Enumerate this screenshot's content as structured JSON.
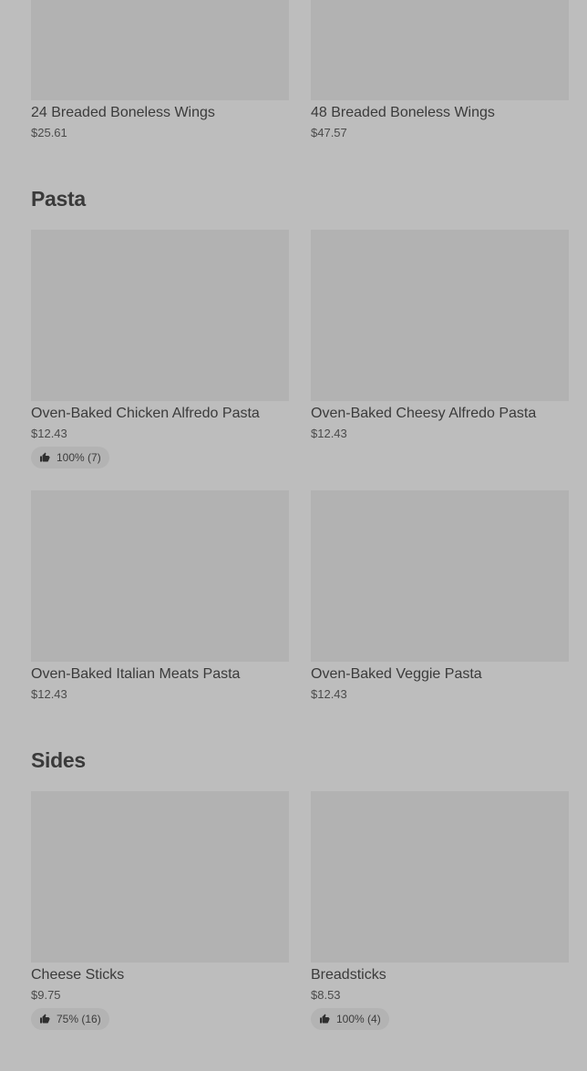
{
  "wings": {
    "items": [
      {
        "name": "24 Breaded Boneless Wings",
        "price": "$25.61"
      },
      {
        "name": "48 Breaded Boneless Wings",
        "price": "$47.57"
      }
    ]
  },
  "pasta": {
    "title": "Pasta",
    "items": [
      {
        "name": "Oven-Baked Chicken Alfredo Pasta",
        "price": "$12.43",
        "rating": "100% (7)"
      },
      {
        "name": "Oven-Baked Cheesy Alfredo Pasta",
        "price": "$12.43"
      },
      {
        "name": "Oven-Baked Italian Meats Pasta",
        "price": "$12.43"
      },
      {
        "name": "Oven-Baked Veggie Pasta",
        "price": "$12.43"
      }
    ]
  },
  "sides": {
    "title": "Sides",
    "items": [
      {
        "name": "Cheese Sticks",
        "price": "$9.75",
        "rating": "75% (16)"
      },
      {
        "name": "Breadsticks",
        "price": "$8.53",
        "rating": "100% (4)"
      }
    ]
  },
  "icons": {
    "rating_icon": "thumbs-up-icon"
  }
}
